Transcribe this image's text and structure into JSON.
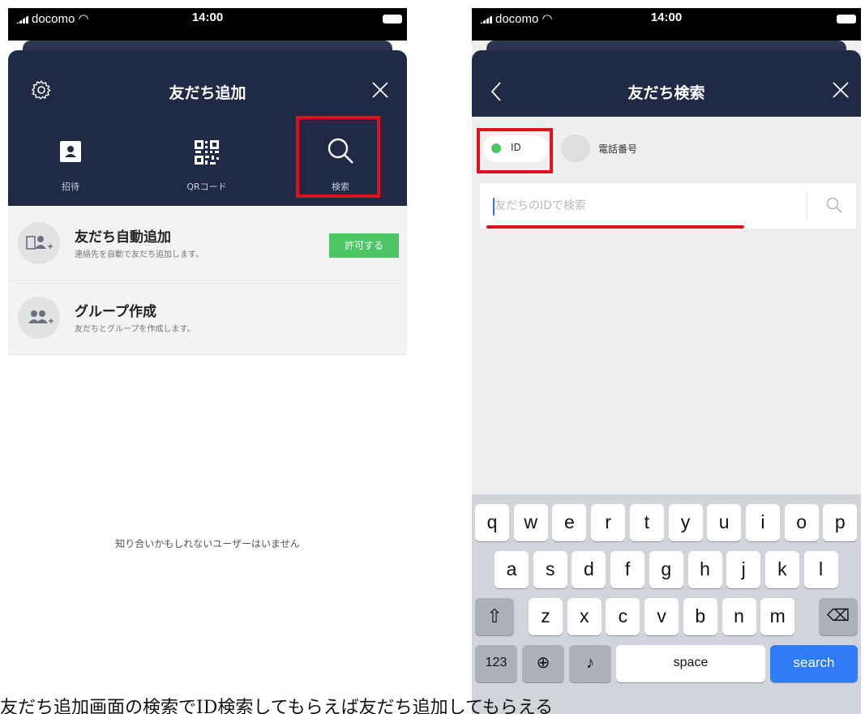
{
  "status_bar": {
    "carrier": "docomo",
    "time": "14:00"
  },
  "left": {
    "header": {
      "title": "友だち追加"
    },
    "tabs": [
      {
        "label": "招待"
      },
      {
        "label": "QRコード"
      },
      {
        "label": "検索"
      }
    ],
    "rows": [
      {
        "title": "友だち自動追加",
        "subtitle": "連絡先を自動で友だち追加します。",
        "button": "許可する"
      },
      {
        "title": "グループ作成",
        "subtitle": "友だちとグループを作成します。"
      }
    ],
    "empty_message": "知り合いかもしれないユーザーはいません"
  },
  "right": {
    "header": {
      "title": "友だち検索"
    },
    "radio": {
      "id_label": "ID",
      "phone_label": "電話番号",
      "selected": "ID"
    },
    "search": {
      "placeholder": "友だちのIDで検索",
      "value": ""
    },
    "keyboard": {
      "row1": [
        "q",
        "w",
        "e",
        "r",
        "t",
        "y",
        "u",
        "i",
        "o",
        "p"
      ],
      "row2": [
        "a",
        "s",
        "d",
        "f",
        "g",
        "h",
        "j",
        "k",
        "l"
      ],
      "row3": [
        "z",
        "x",
        "c",
        "v",
        "b",
        "n",
        "m"
      ],
      "numbers_key": "123",
      "space_key": "space",
      "search_key": "search"
    }
  },
  "caption": "友だち追加画面の検索でID検索してもらえば友だち追加してもらえる",
  "colors": {
    "header_navy": "#202a45",
    "line_green": "#4cc764",
    "highlight_red": "#e0101e",
    "ios_blue": "#2f7cf6"
  }
}
